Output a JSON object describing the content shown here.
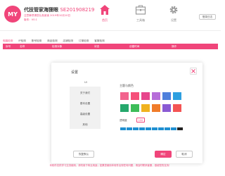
{
  "header": {
    "logo": "MY",
    "title": "代技管家海狸眼",
    "code": "SE201908219",
    "sub1": "注意事项请您认真阅读 2019年10月10日",
    "sub2": "版本：V0.1",
    "log_button": "登录日志"
  },
  "nav": [
    {
      "label": "首页",
      "icon": "home-icon",
      "active": true
    },
    {
      "label": "工具箱",
      "icon": "toolbox-icon",
      "active": false
    },
    {
      "label": "设置",
      "icon": "gear-icon",
      "active": false
    }
  ],
  "tabs": [
    "电脑检测",
    "IP检测",
    "账号检测",
    "商品检测",
    "店铺检测",
    "订单检测",
    "客服检测"
  ],
  "table_headers": [
    "序号",
    "名称",
    "检测对象",
    "状态",
    "创建时间",
    "操作"
  ],
  "footer": "本软件仅供学习交流使用，请勿用于商业用途；如果您使用本软件出现任何问题，请及时联系客服，感谢您的支持！",
  "modal": {
    "title": "设置",
    "menu_heading": "UI",
    "menu_items": [
      "关于我们",
      "基本设置",
      "高级设置",
      "其他"
    ],
    "theme_label": "主题与颜色",
    "colors": [
      "#f2648e",
      "#f5507a",
      "#e7468c",
      "#b66dd9",
      "#4f7fdc",
      "#2e9fe0",
      "#25a86c",
      "#3dbd59",
      "#f0b21f",
      "#f07c2a",
      "#8a5ad3",
      "#f45454"
    ],
    "alpha_label": "透明度",
    "alpha_value": "100",
    "reset_label": "恢复默认",
    "save_label": "确定",
    "cancel_label": "取消"
  }
}
